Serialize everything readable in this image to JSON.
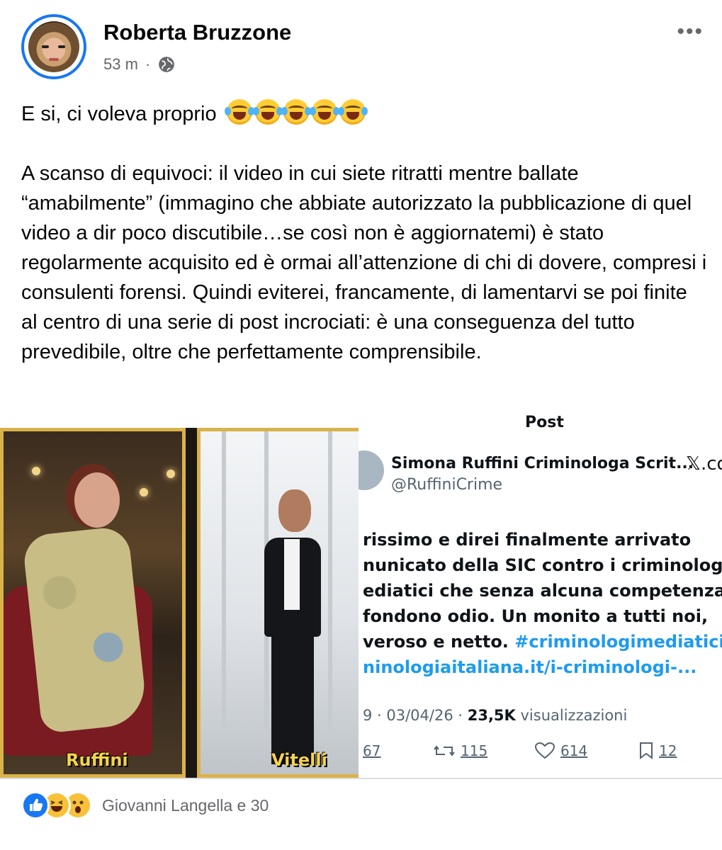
{
  "post": {
    "author": "Roberta Bruzzone",
    "time": "53 m",
    "separator": "·",
    "more_label": "•••",
    "privacy_icon": "globe-icon",
    "text_line1": "E si, ci voleva proprio",
    "text_line1_emoji": "laughing-tears-emoji x5",
    "paragraph": "A scanso di equivoci: il video in cui siete ritratti mentre ballate “amabilmente” (immagino che abbiate autorizzato la pubblicazione di quel video a dir poco discutibile…se così non è aggiornatemi) è stato regolarmente acquisito ed è ormai all’attenzione di chi di dovere, compresi i consulenti forensi. Quindi eviterei, francamente, di lamentarvi se poi finite al centro di una serie di post incrociati: è una conseguenza del tutto prevedibile, oltre che perfettamente comprensibile."
  },
  "collage": {
    "left_label": "Ruffini",
    "right_label": "Vitelli"
  },
  "tweet": {
    "header": "Post",
    "name": "Simona Ruffini Criminologa Scrit...",
    "site": "𝕏.co",
    "handle": "@RuffiniCrime",
    "lines": [
      "rissimo e direi finalmente arrivato",
      "nunicato della SIC contro i criminologi",
      "ediatici che senza alcuna competenza",
      "fondono odio. Un monito a tutti noi,"
    ],
    "line5_text": "veroso e netto. ",
    "line5_link": "#criminologimediatici",
    "line6_link": "ninologiaitaliana.it/i-criminologi-...",
    "meta_date": "9 · 03/04/26 · ",
    "meta_views": "23,5K",
    "meta_views_label": " visualizzazioni",
    "actions": {
      "replies": "67",
      "reposts": "115",
      "likes": "614",
      "bookmarks": "12"
    }
  },
  "reactions": {
    "types": [
      "like",
      "haha",
      "wow"
    ],
    "label": "Giovanni Langella e 30"
  }
}
